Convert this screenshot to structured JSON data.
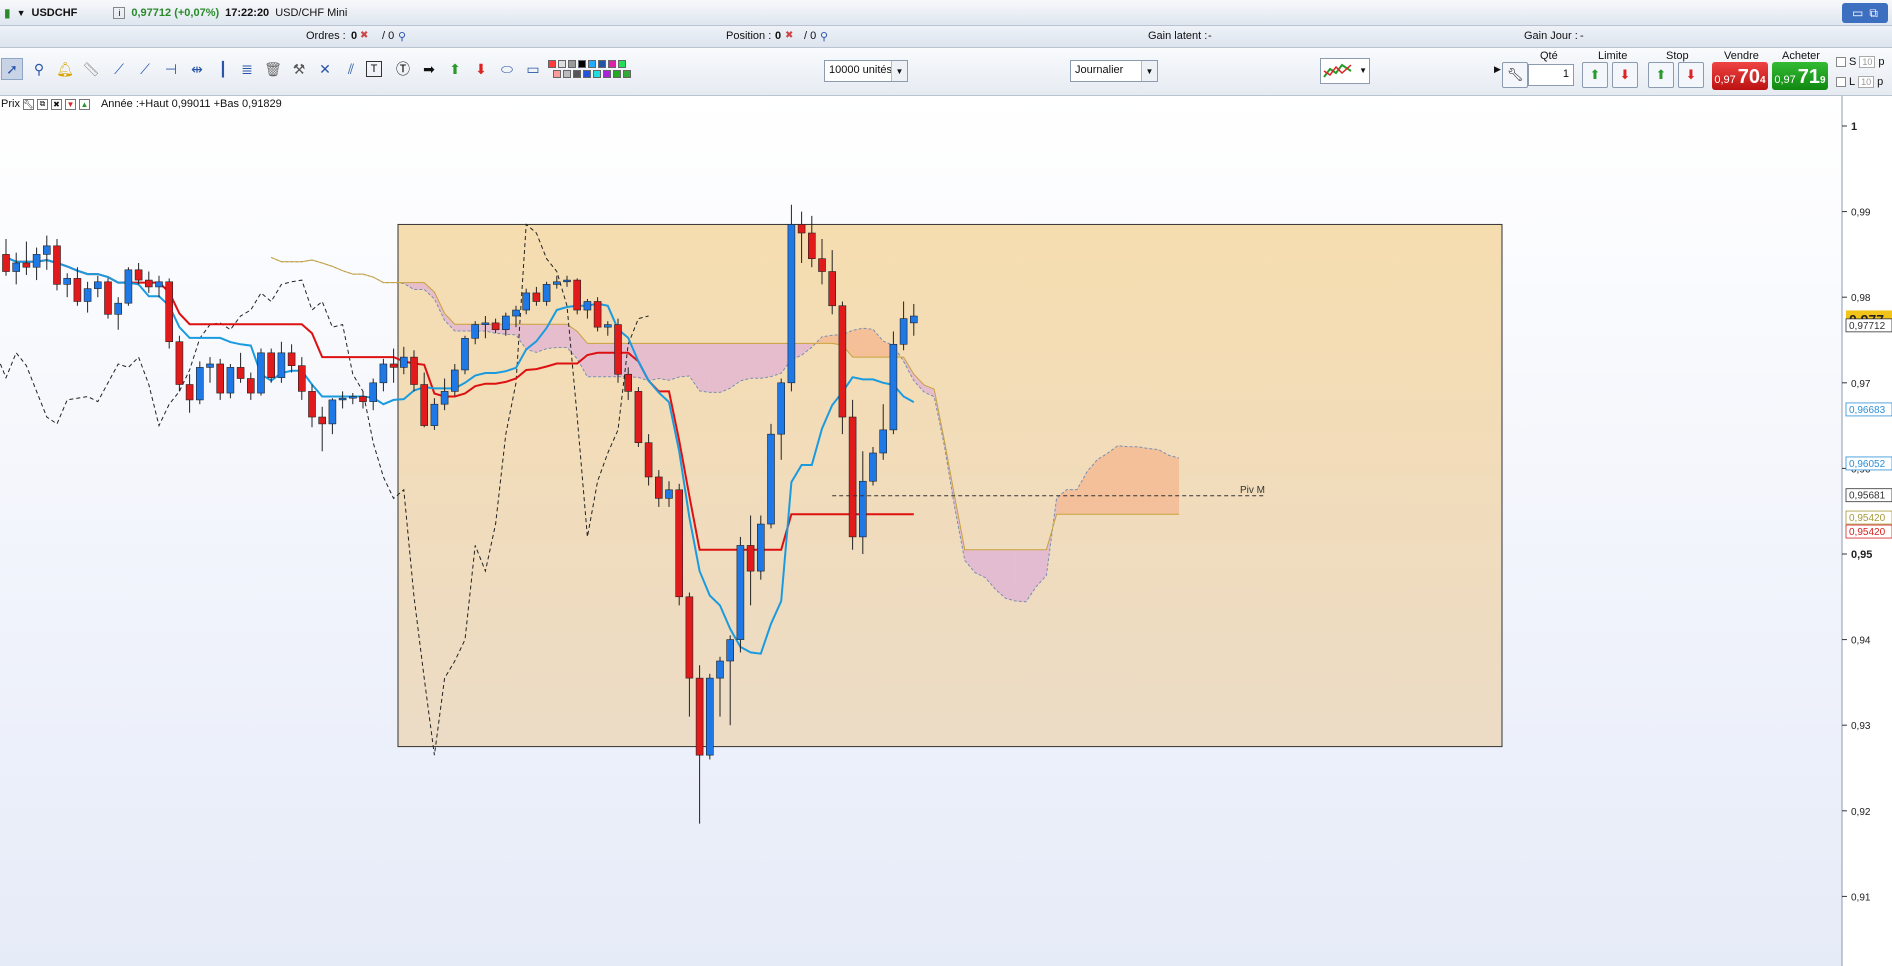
{
  "header": {
    "symbol": "USDCHF",
    "price_change": "0,97712 (+0,07%)",
    "time": "17:22:20",
    "instrument": "USD/CHF Mini"
  },
  "infobar": {
    "orders_label": "Ordres :",
    "orders_value": "0",
    "orders_total": "/ 0",
    "position_label": "Position :",
    "position_value": "0",
    "position_total": "/ 0",
    "gain_latent_label": "Gain latent :",
    "gain_latent_value": "-",
    "gain_jour_label": "Gain Jour :",
    "gain_jour_value": "-"
  },
  "toolbar": {
    "units_select": "10000 unités",
    "period_select": "Journalier",
    "icons": [
      "pointer-icon",
      "zoom-icon",
      "alert-bell-icon",
      "ruler-icon",
      "line-icon",
      "ray-icon",
      "horizontal-line-icon",
      "segment-icon",
      "vertical-line-icon",
      "fibonacci-icon",
      "trash-icon",
      "tools-icon",
      "cross-icon",
      "channel-icon",
      "text-icon",
      "text-bubble-icon",
      "arrow-right-icon",
      "arrow-up-icon",
      "arrow-down-icon",
      "ellipse-icon",
      "rectangle-icon"
    ],
    "palette_colors": [
      "#ff3b3b",
      "#ff9a9a",
      "#dddddd",
      "#bbbbbb",
      "#999999",
      "#555555",
      "#000000",
      "#2255dd",
      "#22aaff",
      "#22dddd",
      "#2255aa",
      "#aa22dd",
      "#dd22aa",
      "#22aa22",
      "#22dd55",
      "#33aa33"
    ]
  },
  "trade_panel": {
    "qty_label": "Qté",
    "qty_value": "1",
    "limit_label": "Limite",
    "stop_label": "Stop",
    "sell_label": "Vendre",
    "buy_label": "Acheter",
    "sell_small": "0,97",
    "sell_big": "70",
    "sell_sup": "4",
    "buy_small": "0,97",
    "buy_big": "71",
    "buy_sup": "9",
    "s_label": "S",
    "s_value": "10",
    "s_unit": "p",
    "l_label": "L",
    "l_value": "10",
    "l_unit": "p"
  },
  "chart_toolbar": {
    "price_label": "Prix",
    "range_text": "Année :+Haut 0,99011 +Bas 0,91829"
  },
  "chart_data": {
    "type": "candlestick",
    "yaxis_ticks": [
      "1",
      "0,99",
      "0,98",
      "0,97",
      "0,96",
      "0,95",
      "0,94",
      "0,93",
      "0,92",
      "0,91"
    ],
    "ylim": [
      0.906,
      1.0
    ],
    "price_tags": [
      {
        "label": "0,977",
        "value": 0.9774,
        "color": "#f2c319",
        "bold": true
      },
      {
        "label": "0,97712",
        "value": 0.97712,
        "color": "#333333"
      },
      {
        "label": "0,96683",
        "value": 0.96683,
        "color": "#2a8fd8"
      },
      {
        "label": "0,96052",
        "value": 0.96052,
        "color": "#2a8fd8"
      },
      {
        "label": "0,95681",
        "value": 0.95681,
        "color": "#333333"
      },
      {
        "label": "0,95420",
        "value": 0.9542,
        "color": "#a59a3a"
      },
      {
        "label": "0,95420",
        "value": 0.9542,
        "color": "#d62020"
      }
    ],
    "annotation": {
      "label": "Piv M",
      "value": 0.9568
    },
    "highlight_box": {
      "y_top": 0.9885,
      "y_bottom": 0.9275
    },
    "candles": [
      [
        0.985,
        0.9868,
        0.9825,
        0.983
      ],
      [
        0.983,
        0.9852,
        0.9815,
        0.984
      ],
      [
        0.984,
        0.9865,
        0.9826,
        0.9835
      ],
      [
        0.9835,
        0.9858,
        0.982,
        0.985
      ],
      [
        0.985,
        0.9872,
        0.9832,
        0.986
      ],
      [
        0.986,
        0.9868,
        0.9808,
        0.9815
      ],
      [
        0.9815,
        0.9828,
        0.98,
        0.9822
      ],
      [
        0.9822,
        0.9835,
        0.979,
        0.9795
      ],
      [
        0.9795,
        0.9818,
        0.9782,
        0.981
      ],
      [
        0.981,
        0.9825,
        0.98,
        0.9818
      ],
      [
        0.9818,
        0.9822,
        0.9775,
        0.978
      ],
      [
        0.978,
        0.98,
        0.9762,
        0.9793
      ],
      [
        0.9793,
        0.9835,
        0.979,
        0.9832
      ],
      [
        0.9832,
        0.984,
        0.9815,
        0.982
      ],
      [
        0.982,
        0.983,
        0.9805,
        0.9812
      ],
      [
        0.9812,
        0.9825,
        0.98,
        0.9818
      ],
      [
        0.9818,
        0.9822,
        0.974,
        0.9748
      ],
      [
        0.9748,
        0.9755,
        0.969,
        0.9698
      ],
      [
        0.9698,
        0.971,
        0.9665,
        0.968
      ],
      [
        0.968,
        0.9725,
        0.9675,
        0.9718
      ],
      [
        0.9718,
        0.973,
        0.97,
        0.9722
      ],
      [
        0.9722,
        0.9728,
        0.968,
        0.9688
      ],
      [
        0.9688,
        0.9722,
        0.9682,
        0.9718
      ],
      [
        0.9718,
        0.9735,
        0.97,
        0.9705
      ],
      [
        0.9705,
        0.9712,
        0.968,
        0.9688
      ],
      [
        0.9688,
        0.974,
        0.9685,
        0.9735
      ],
      [
        0.9735,
        0.974,
        0.97,
        0.9706
      ],
      [
        0.9706,
        0.9748,
        0.97,
        0.9735
      ],
      [
        0.9735,
        0.9745,
        0.9712,
        0.972
      ],
      [
        0.972,
        0.973,
        0.968,
        0.969
      ],
      [
        0.969,
        0.9698,
        0.9648,
        0.966
      ],
      [
        0.966,
        0.9672,
        0.962,
        0.9652
      ],
      [
        0.9652,
        0.9682,
        0.964,
        0.968
      ],
      [
        0.968,
        0.969,
        0.967,
        0.9682
      ],
      [
        0.9682,
        0.9688,
        0.9675,
        0.9684
      ],
      [
        0.9684,
        0.969,
        0.967,
        0.9678
      ],
      [
        0.9678,
        0.9705,
        0.9668,
        0.97
      ],
      [
        0.97,
        0.9728,
        0.969,
        0.9722
      ],
      [
        0.9722,
        0.974,
        0.97,
        0.9718
      ],
      [
        0.9718,
        0.9742,
        0.971,
        0.973
      ],
      [
        0.973,
        0.9738,
        0.969,
        0.9698
      ],
      [
        0.9698,
        0.9712,
        0.9648,
        0.965
      ],
      [
        0.965,
        0.9682,
        0.9645,
        0.9675
      ],
      [
        0.9675,
        0.9705,
        0.9668,
        0.969
      ],
      [
        0.969,
        0.9722,
        0.9685,
        0.9715
      ],
      [
        0.9715,
        0.9755,
        0.971,
        0.9752
      ],
      [
        0.9752,
        0.9772,
        0.9745,
        0.9768
      ],
      [
        0.9768,
        0.9778,
        0.9752,
        0.977
      ],
      [
        0.977,
        0.9775,
        0.9758,
        0.9762
      ],
      [
        0.9762,
        0.9782,
        0.9755,
        0.9778
      ],
      [
        0.9778,
        0.979,
        0.9765,
        0.9785
      ],
      [
        0.9785,
        0.981,
        0.978,
        0.9805
      ],
      [
        0.9805,
        0.9812,
        0.979,
        0.9795
      ],
      [
        0.9795,
        0.9818,
        0.979,
        0.9815
      ],
      [
        0.9815,
        0.9825,
        0.981,
        0.9818
      ],
      [
        0.9818,
        0.9825,
        0.9812,
        0.982
      ],
      [
        0.982,
        0.9822,
        0.978,
        0.9785
      ],
      [
        0.9785,
        0.9798,
        0.9775,
        0.9795
      ],
      [
        0.9795,
        0.98,
        0.976,
        0.9765
      ],
      [
        0.9765,
        0.9772,
        0.9755,
        0.9768
      ],
      [
        0.9768,
        0.9775,
        0.97,
        0.971
      ],
      [
        0.971,
        0.9718,
        0.968,
        0.969
      ],
      [
        0.969,
        0.9695,
        0.9625,
        0.963
      ],
      [
        0.963,
        0.964,
        0.958,
        0.959
      ],
      [
        0.959,
        0.9598,
        0.9555,
        0.9565
      ],
      [
        0.9565,
        0.9585,
        0.9555,
        0.9575
      ],
      [
        0.9575,
        0.9582,
        0.944,
        0.945
      ],
      [
        0.945,
        0.9455,
        0.931,
        0.9355
      ],
      [
        0.9355,
        0.937,
        0.9185,
        0.9265
      ],
      [
        0.9265,
        0.936,
        0.926,
        0.9355
      ],
      [
        0.9355,
        0.938,
        0.931,
        0.9375
      ],
      [
        0.9375,
        0.9405,
        0.93,
        0.94
      ],
      [
        0.94,
        0.952,
        0.9385,
        0.951
      ],
      [
        0.951,
        0.9545,
        0.944,
        0.948
      ],
      [
        0.948,
        0.9545,
        0.947,
        0.9535
      ],
      [
        0.9535,
        0.9652,
        0.953,
        0.964
      ],
      [
        0.964,
        0.9705,
        0.961,
        0.97
      ],
      [
        0.97,
        0.9908,
        0.969,
        0.9885
      ],
      [
        0.9885,
        0.99,
        0.984,
        0.9875
      ],
      [
        0.9875,
        0.9895,
        0.9835,
        0.9845
      ],
      [
        0.9845,
        0.9868,
        0.9815,
        0.983
      ],
      [
        0.983,
        0.9855,
        0.978,
        0.979
      ],
      [
        0.979,
        0.9795,
        0.964,
        0.966
      ],
      [
        0.966,
        0.968,
        0.9505,
        0.952
      ],
      [
        0.952,
        0.962,
        0.95,
        0.9585
      ],
      [
        0.9585,
        0.9625,
        0.958,
        0.9618
      ],
      [
        0.9618,
        0.9675,
        0.961,
        0.9645
      ],
      [
        0.9645,
        0.976,
        0.964,
        0.9745
      ],
      [
        0.9745,
        0.9795,
        0.9738,
        0.9775
      ],
      [
        0.977,
        0.9792,
        0.9755,
        0.9778
      ]
    ],
    "x_start": 6,
    "x_step": 10.2
  }
}
